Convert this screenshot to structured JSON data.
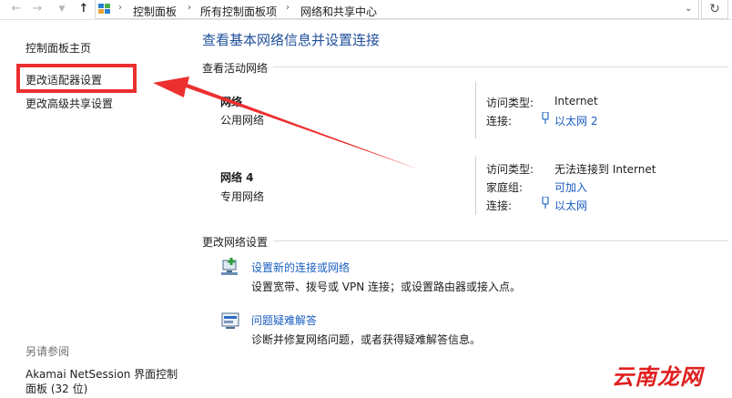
{
  "nav": {
    "back_icon": "back-arrow-icon",
    "forward_icon": "forward-arrow-icon",
    "dropdown_icon": "chevron-down-icon",
    "up_icon": "up-arrow-icon",
    "refresh_icon": "refresh-icon"
  },
  "breadcrumb": {
    "items": [
      "控制面板",
      "所有控制面板项",
      "网络和共享中心"
    ]
  },
  "sidebar": {
    "items": [
      {
        "label": "控制面板主页"
      },
      {
        "label": "更改适配器设置"
      },
      {
        "label": "更改高级共享设置"
      }
    ],
    "see_also_title": "另请参阅",
    "see_also_line1": "Akamai NetSession 界面控制",
    "see_also_line2": "面板 (32 位)"
  },
  "main": {
    "title": "查看基本网络信息并设置连接",
    "active_section": "查看活动网络",
    "networks": [
      {
        "name": "网络",
        "type": "公用网络",
        "access_label": "访问类型:",
        "access_value": "Internet",
        "conn_label": "连接:",
        "conn_value": "以太网 2"
      },
      {
        "name": "网络  4",
        "type": "专用网络",
        "access_label": "访问类型:",
        "access_value": "无法连接到 Internet",
        "homegroup_label": "家庭组:",
        "homegroup_value": "可加入",
        "conn_label": "连接:",
        "conn_value": "以太网"
      }
    ],
    "change_section": "更改网络设置",
    "tasks": [
      {
        "link": "设置新的连接或网络",
        "desc": "设置宽带、拨号或 VPN 连接；或设置路由器或接入点。"
      },
      {
        "link": "问题疑难解答",
        "desc": "诊断并修复网络问题，或者获得疑难解答信息。"
      }
    ]
  },
  "annotation": {
    "color": "#ec2f2f"
  },
  "watermark": "云南龙网"
}
